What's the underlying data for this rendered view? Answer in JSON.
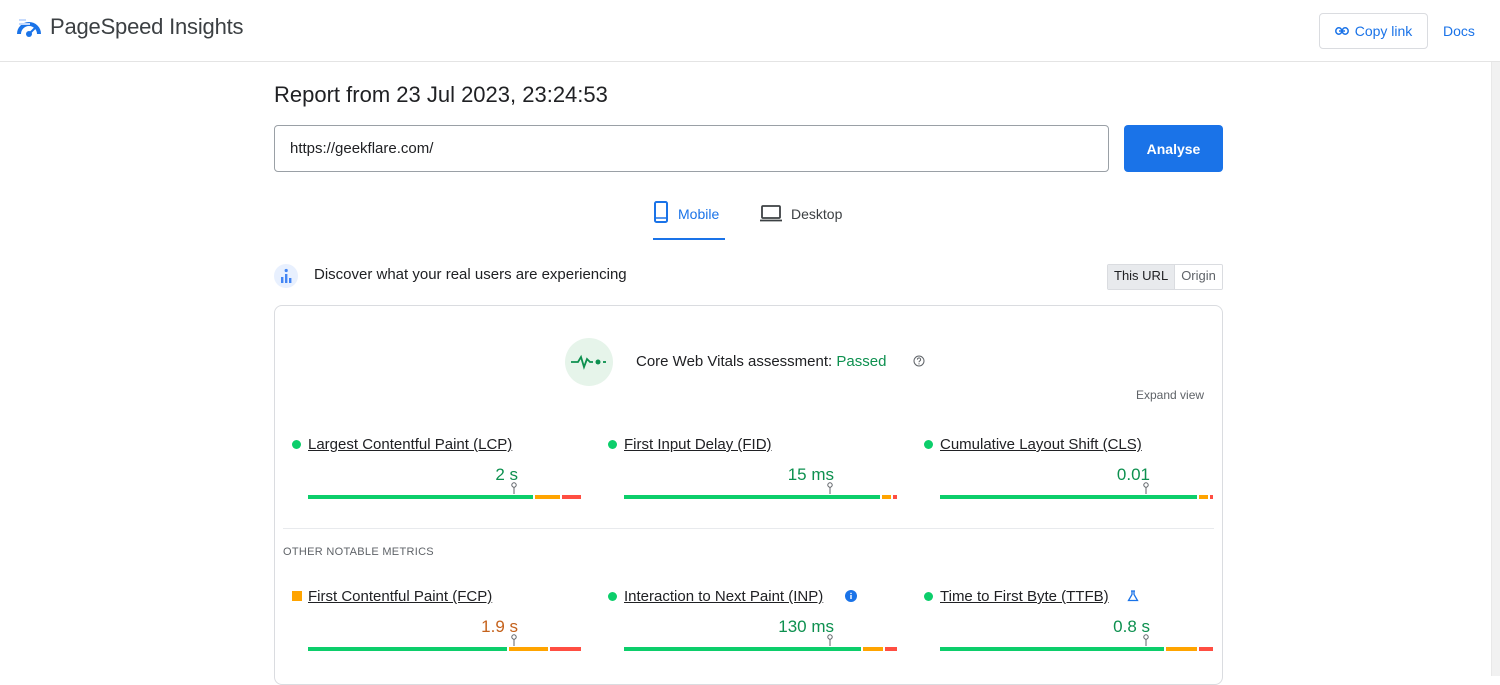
{
  "header": {
    "app_name": "PageSpeed Insights",
    "copy_link_label": "Copy link",
    "docs_label": "Docs"
  },
  "report": {
    "title": "Report from 23 Jul 2023, 23:24:53",
    "url_value": "https://geekflare.com/",
    "analyse_label": "Analyse"
  },
  "tabs": [
    {
      "label": "Mobile",
      "active": true
    },
    {
      "label": "Desktop",
      "active": false
    }
  ],
  "field_data": {
    "heading": "Discover what your real users are experiencing",
    "toggle": [
      {
        "label": "This URL",
        "selected": true
      },
      {
        "label": "Origin",
        "selected": false
      }
    ]
  },
  "cwv": {
    "assessment_label": "Core Web Vitals assessment:",
    "assessment_result": "Passed",
    "expand_view_label": "Expand view"
  },
  "core_metrics": [
    {
      "name": "Largest Contentful Paint (LCP)",
      "value": "2 s",
      "status": "good",
      "distribution": [
        0.75,
        0.09,
        0.07
      ],
      "marker": 0.75
    },
    {
      "name": "First Input Delay (FID)",
      "value": "15 ms",
      "status": "good",
      "distribution": [
        0.93,
        0.04,
        0.02
      ],
      "marker": 0.75
    },
    {
      "name": "Cumulative Layout Shift (CLS)",
      "value": "0.01",
      "status": "good",
      "distribution": [
        0.94,
        0.04,
        0.02
      ],
      "marker": 0.75
    }
  ],
  "other_heading": "OTHER NOTABLE METRICS",
  "other_metrics": [
    {
      "name": "First Contentful Paint (FCP)",
      "value": "1.9 s",
      "status": "average",
      "distribution": [
        0.73,
        0.15,
        0.12
      ],
      "marker": 0.75,
      "extra_icon": ""
    },
    {
      "name": "Interaction to Next Paint (INP)",
      "value": "130 ms",
      "status": "good",
      "distribution": [
        0.86,
        0.08,
        0.05
      ],
      "marker": 0.75,
      "extra_icon": "info-icon"
    },
    {
      "name": "Time to First Byte (TTFB)",
      "value": "0.8 s",
      "status": "good",
      "distribution": [
        0.82,
        0.12,
        0.06
      ],
      "marker": 0.75,
      "extra_icon": "flask-icon"
    }
  ],
  "colors": {
    "good": "#0cce6b",
    "average": "#ffa400",
    "poor": "#ff4e42",
    "accent": "#1a73e8"
  }
}
